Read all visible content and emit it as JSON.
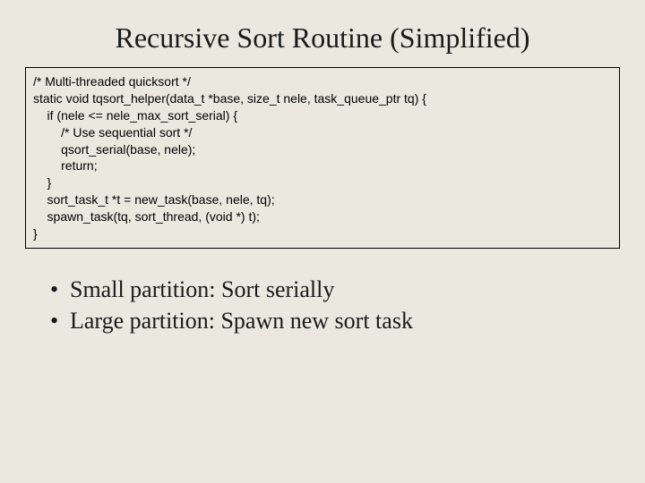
{
  "title": "Recursive Sort Routine (Simplified)",
  "code": "/* Multi-threaded quicksort */\nstatic void tqsort_helper(data_t *base, size_t nele, task_queue_ptr tq) {\n    if (nele <= nele_max_sort_serial) {\n        /* Use sequential sort */\n        qsort_serial(base, nele);\n        return;\n    }\n    sort_task_t *t = new_task(base, nele, tq);\n    spawn_task(tq, sort_thread, (void *) t);\n}",
  "bullets": {
    "0": {
      "dot": "•",
      "text": "Small partition: Sort serially"
    },
    "1": {
      "dot": "•",
      "text": "Large partition: Spawn new sort task"
    }
  }
}
